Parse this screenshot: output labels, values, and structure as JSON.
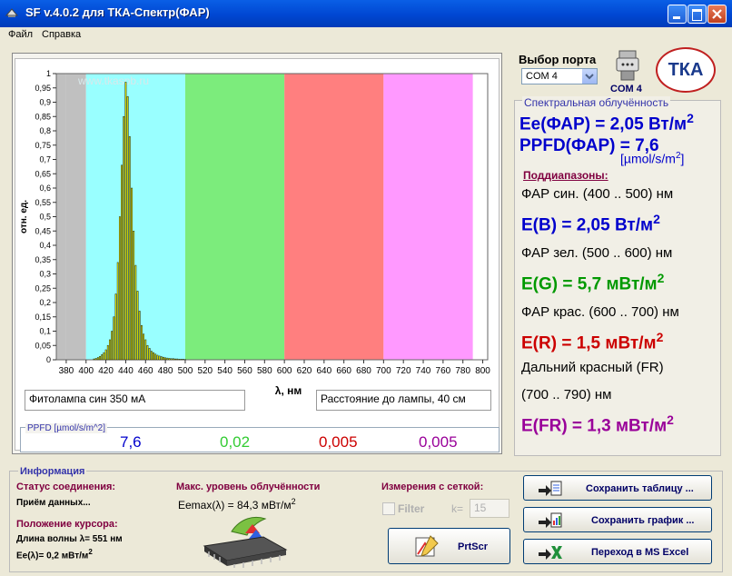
{
  "window": {
    "title": "SF v.4.0.2 для ТКА-Спектр(ФАР)"
  },
  "menu": {
    "file": "Файл",
    "help": "Справка"
  },
  "port": {
    "label": "Выбор порта",
    "selected": "COM 4",
    "device_label": "COM  4",
    "logo_text": "ТКА"
  },
  "plot": {
    "watermark": "www.tkaspb.ru",
    "ylabel": "отн. ед.",
    "xlabel": "λ, нм",
    "xticks": [
      "380",
      "400",
      "420",
      "440",
      "460",
      "480",
      "500",
      "520",
      "540",
      "560",
      "580",
      "600",
      "620",
      "640",
      "660",
      "680",
      "700",
      "720",
      "740",
      "760",
      "780",
      "800"
    ],
    "yticks": [
      "1",
      "0,95",
      "0,9",
      "0,85",
      "0,8",
      "0,75",
      "0,7",
      "0,65",
      "0,6",
      "0,55",
      "0,5",
      "0,45",
      "0,4",
      "0,35",
      "0,3",
      "0,25",
      "0,2",
      "0,15",
      "0,1",
      "0,05",
      "0"
    ]
  },
  "chart_data": {
    "type": "bar",
    "xlabel": "λ, нм",
    "ylabel": "отн. ед.",
    "xlim": [
      370,
      805
    ],
    "ylim": [
      0,
      1
    ],
    "bands": [
      {
        "from": 370,
        "to": 380,
        "color": "#C0C0C0"
      },
      {
        "from": 380,
        "to": 400,
        "color": "#C0C0C0"
      },
      {
        "from": 400,
        "to": 500,
        "color": "#99FFFF"
      },
      {
        "from": 500,
        "to": 600,
        "color": "#7CEC7C"
      },
      {
        "from": 600,
        "to": 700,
        "color": "#FF7F7F"
      },
      {
        "from": 700,
        "to": 790,
        "color": "#FF99FF"
      }
    ],
    "x": [
      408,
      410,
      412,
      414,
      416,
      418,
      420,
      422,
      424,
      426,
      428,
      430,
      432,
      434,
      436,
      438,
      440,
      442,
      444,
      446,
      448,
      450,
      452,
      454,
      456,
      458,
      460,
      462,
      464,
      466,
      468,
      470,
      472,
      474,
      476,
      478,
      480,
      482,
      484,
      486,
      488,
      490,
      492,
      494,
      496,
      498,
      500
    ],
    "values": [
      0.003,
      0.005,
      0.008,
      0.012,
      0.018,
      0.025,
      0.035,
      0.05,
      0.07,
      0.1,
      0.15,
      0.23,
      0.34,
      0.5,
      0.68,
      0.85,
      0.97,
      0.92,
      0.78,
      0.6,
      0.45,
      0.33,
      0.24,
      0.17,
      0.12,
      0.09,
      0.07,
      0.05,
      0.04,
      0.03,
      0.025,
      0.02,
      0.016,
      0.013,
      0.011,
      0.009,
      0.007,
      0.006,
      0.005,
      0.004,
      0.004,
      0.003,
      0.003,
      0.002,
      0.002,
      0.002,
      0.001
    ],
    "bar_color": "#FFFF00"
  },
  "fields": {
    "lamp": "Фитолампа син 350 мА",
    "distance": "Расстояние до лампы, 40 см"
  },
  "ppfd": {
    "label": "PPFD [µmol/s/m^2]",
    "blue": "7,6",
    "green": "0,02",
    "red": "0,005",
    "farred": "0,005"
  },
  "spectral": {
    "heading": "Спектральная облучённость",
    "ee_far": "Ee(ФАР) = 2,05 Вт/м",
    "ppfd_far": "PPFD(ФАР) = 7,6",
    "ppfd_unit": "[µmol/s/m",
    "sub_heading": "Поддиапазоны:",
    "blue_range": "ФАР син. (400 .. 500) нм",
    "eb": "E(B) = 2,05 Вт/м",
    "green_range": "ФАР зел. (500 .. 600) нм",
    "eg": "E(G) = 5,7 мВт/м",
    "red_range": "ФАР крас. (600 .. 700) нм",
    "er": "E(R) = 1,5 мВт/м",
    "fr_title": "Дальний красный (FR)",
    "fr_range": "(700 .. 790) нм",
    "efr": "E(FR) = 1,3 мВт/м",
    "sup2": "2",
    "close_bracket": "]"
  },
  "info": {
    "title": "Информация",
    "conn_label": "Статус соединения:",
    "conn_value": "Приём данных...",
    "cursor_label": "Положение курсора:",
    "cursor_wl": "Длина волны λ= 551 нм",
    "cursor_e": "Ee(λ)= 0,2 мВт/м",
    "max_label": "Макс. уровень облучённости",
    "max_value": "Eemax(λ) = 84,3 мВт/м",
    "grid_label": "Измерения с сеткой:",
    "filter_label": "Filter",
    "k_label": "k=",
    "k_value": "15",
    "prtscr": "PrtScr",
    "save_table": "Сохранить таблицу ...",
    "save_chart": "Сохранить график ...",
    "excel": "Переход в MS Excel"
  },
  "colors": {
    "blue": "#0000CC",
    "green": "#009900",
    "red": "#CC0000",
    "purple": "#990099",
    "maroon": "#800040"
  }
}
